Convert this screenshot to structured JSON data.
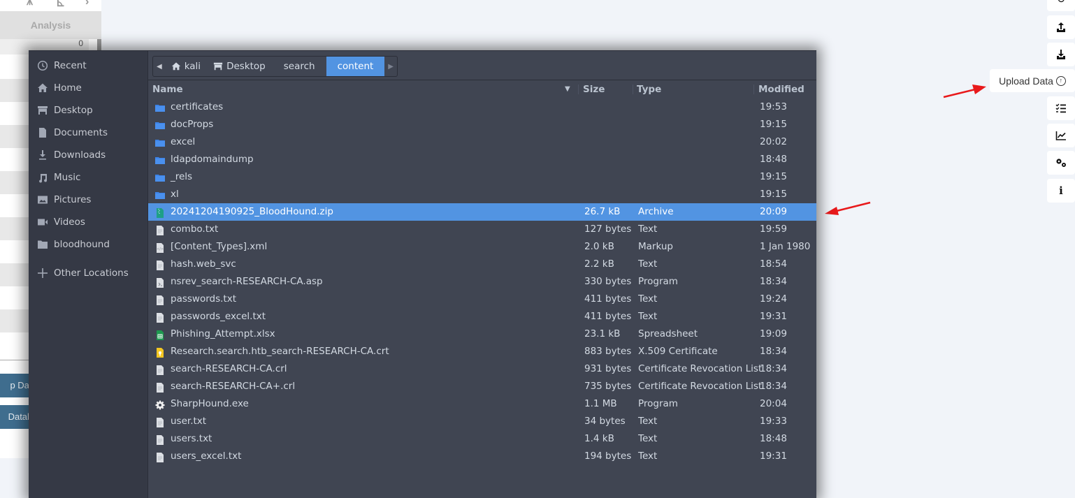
{
  "background_app": {
    "analysis_tab": "Analysis",
    "count_value": "0",
    "buttons": [
      {
        "label": "Clear Database (partial)",
        "visible_text": "p Datab"
      },
      {
        "label": "Database",
        "visible_text": "Databas"
      }
    ],
    "right_toolbar": {
      "icons": [
        "refresh-icon",
        "export-icon",
        "import-icon",
        "upload-data-icon",
        "query-list-icon",
        "chart-icon",
        "settings-icon",
        "info-icon"
      ],
      "upload_tooltip": "Upload Data"
    },
    "annotation_color": "#e8191b"
  },
  "file_chooser": {
    "places": [
      {
        "label": "Recent",
        "icon": "clock-icon"
      },
      {
        "label": "Home",
        "icon": "home-icon"
      },
      {
        "label": "Desktop",
        "icon": "desktop-icon"
      },
      {
        "label": "Documents",
        "icon": "document-icon"
      },
      {
        "label": "Downloads",
        "icon": "download-icon"
      },
      {
        "label": "Music",
        "icon": "music-icon"
      },
      {
        "label": "Pictures",
        "icon": "picture-icon"
      },
      {
        "label": "Videos",
        "icon": "video-icon"
      },
      {
        "label": "bloodhound",
        "icon": "folder-icon"
      },
      {
        "label": "Other Locations",
        "icon": "plus-icon"
      }
    ],
    "path": [
      {
        "label": "kali",
        "icon": "home-icon"
      },
      {
        "label": "Desktop",
        "icon": "desktop-icon"
      },
      {
        "label": "search"
      },
      {
        "label": "content",
        "active": true
      }
    ],
    "columns": {
      "name": "Name",
      "size": "Size",
      "type": "Type",
      "modified": "Modified"
    },
    "accent_color": "#5294e2",
    "files": [
      {
        "name": "certificates",
        "size": "",
        "type": "",
        "modified": "19:53",
        "kind": "folder"
      },
      {
        "name": "docProps",
        "size": "",
        "type": "",
        "modified": "19:15",
        "kind": "folder"
      },
      {
        "name": "excel",
        "size": "",
        "type": "",
        "modified": "20:02",
        "kind": "folder"
      },
      {
        "name": "ldapdomaindump",
        "size": "",
        "type": "",
        "modified": "18:48",
        "kind": "folder"
      },
      {
        "name": "_rels",
        "size": "",
        "type": "",
        "modified": "19:15",
        "kind": "folder"
      },
      {
        "name": "xl",
        "size": "",
        "type": "",
        "modified": "19:15",
        "kind": "folder"
      },
      {
        "name": "20241204190925_BloodHound.zip",
        "size": "26.7 kB",
        "type": "Archive",
        "modified": "20:09",
        "kind": "archive",
        "selected": true
      },
      {
        "name": "combo.txt",
        "size": "127 bytes",
        "type": "Text",
        "modified": "19:59",
        "kind": "text"
      },
      {
        "name": "[Content_Types].xml",
        "size": "2.0 kB",
        "type": "Markup",
        "modified": "1 Jan 1980",
        "kind": "markup"
      },
      {
        "name": "hash.web_svc",
        "size": "2.2 kB",
        "type": "Text",
        "modified": "18:54",
        "kind": "text"
      },
      {
        "name": "nsrev_search-RESEARCH-CA.asp",
        "size": "330 bytes",
        "type": "Program",
        "modified": "18:34",
        "kind": "script"
      },
      {
        "name": "passwords.txt",
        "size": "411 bytes",
        "type": "Text",
        "modified": "19:24",
        "kind": "text"
      },
      {
        "name": "passwords_excel.txt",
        "size": "411 bytes",
        "type": "Text",
        "modified": "19:31",
        "kind": "text"
      },
      {
        "name": "Phishing_Attempt.xlsx",
        "size": "23.1 kB",
        "type": "Spreadsheet",
        "modified": "19:09",
        "kind": "spreadsheet"
      },
      {
        "name": "Research.search.htb_search-RESEARCH-CA.crt",
        "size": "883 bytes",
        "type": "X.509 Certificate",
        "modified": "18:34",
        "kind": "certificate"
      },
      {
        "name": "search-RESEARCH-CA.crl",
        "size": "931 bytes",
        "type": "Certificate Revocation List",
        "modified": "18:34",
        "kind": "text"
      },
      {
        "name": "search-RESEARCH-CA+.crl",
        "size": "735 bytes",
        "type": "Certificate Revocation List",
        "modified": "18:34",
        "kind": "text"
      },
      {
        "name": "SharpHound.exe",
        "size": "1.1 MB",
        "type": "Program",
        "modified": "20:04",
        "kind": "executable"
      },
      {
        "name": "user.txt",
        "size": "34 bytes",
        "type": "Text",
        "modified": "19:33",
        "kind": "text"
      },
      {
        "name": "users.txt",
        "size": "1.4 kB",
        "type": "Text",
        "modified": "18:48",
        "kind": "text"
      },
      {
        "name": "users_excel.txt",
        "size": "194 bytes",
        "type": "Text",
        "modified": "19:31",
        "kind": "text"
      }
    ]
  }
}
